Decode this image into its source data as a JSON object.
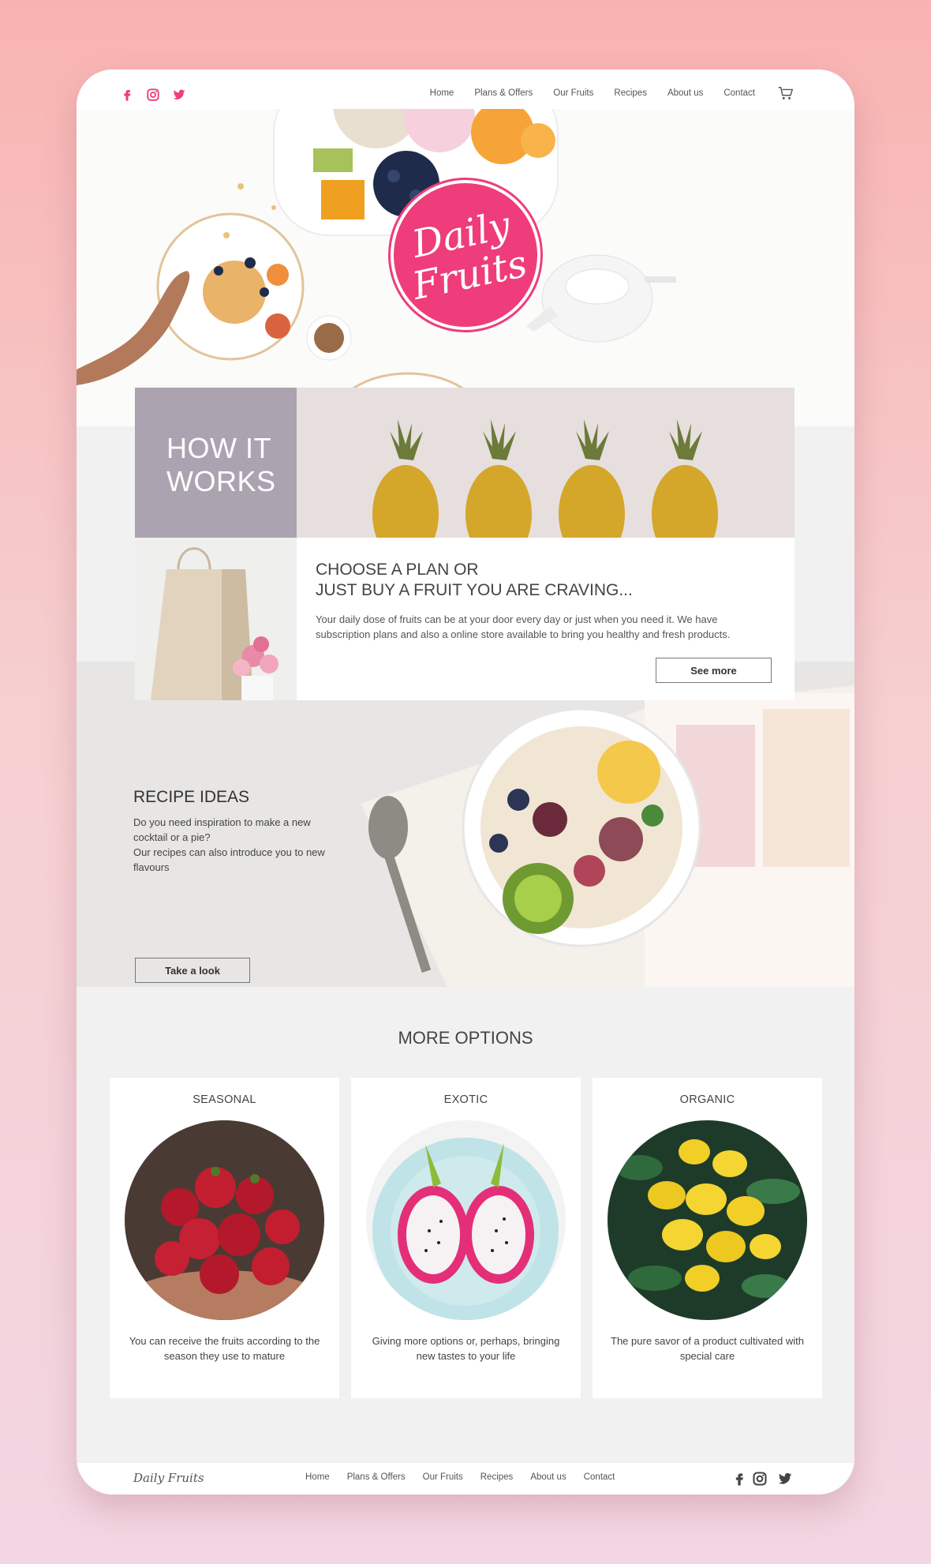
{
  "brand": {
    "name": "Daily Fruits",
    "logo_line1": "Daily",
    "logo_line2": "Fruits"
  },
  "social": [
    "facebook-icon",
    "instagram-icon",
    "twitter-icon"
  ],
  "nav": [
    "Home",
    "Plans & Offers",
    "Our Fruits",
    "Recipes",
    "About us",
    "Contact"
  ],
  "how": {
    "title_line1": "HOW IT",
    "title_line2": "WORKS"
  },
  "plan": {
    "title_line1": "CHOOSE A PLAN OR",
    "title_line2": "JUST BUY A FRUIT YOU ARE CRAVING...",
    "text": "Your daily dose of fruits can be at your door every day or just when you need it. We have subscription plans and also a online store available to bring you healthy and fresh products.",
    "button": "See more"
  },
  "recipe": {
    "title": "RECIPE IDEAS",
    "text1": "Do you need inspiration to make a new cocktail or a pie?",
    "text2": "Our recipes can also introduce you to new flavours",
    "button": "Take a look"
  },
  "more": {
    "title": "MORE OPTIONS",
    "cards": [
      {
        "title": "SEASONAL",
        "text": "You can receive the fruits according to the season they use to mature"
      },
      {
        "title": "EXOTIC",
        "text": "Giving more options or, perhaps, bringing new tastes to your life"
      },
      {
        "title": "ORGANIC",
        "text": "The pure savor of a product cultivated with special care"
      }
    ]
  },
  "footer": {
    "brand": "Daily Fruits",
    "links": [
      "Home",
      "Plans & Offers",
      "Our Fruits",
      "Recipes",
      "About us",
      "Contact"
    ]
  },
  "colors": {
    "accent": "#ee3d7a",
    "how_box": "#aba3b0",
    "bg_top": "#f8b3b1",
    "bg_bottom": "#f2d6e2"
  }
}
